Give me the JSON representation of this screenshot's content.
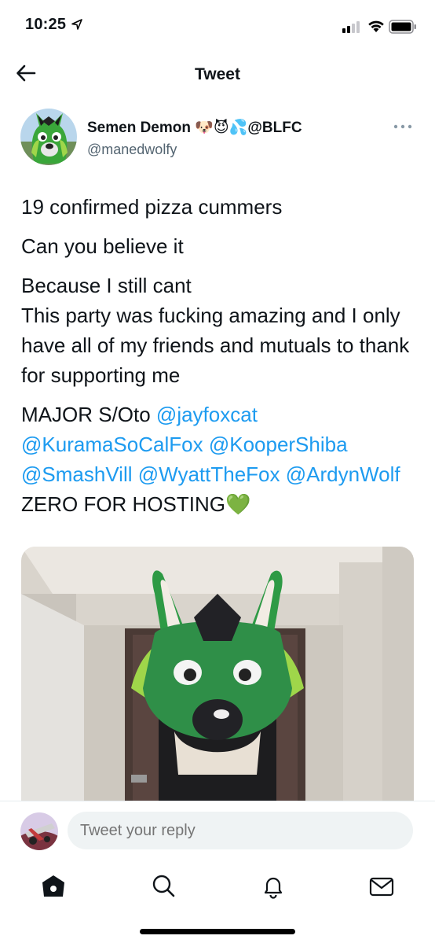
{
  "status": {
    "time": "10:25"
  },
  "nav": {
    "title": "Tweet"
  },
  "author": {
    "display_name": "Semen Demon 🐶😈💦@BLFC",
    "handle": "@manedwolfy"
  },
  "tweet": {
    "line1": "19 confirmed pizza cummers",
    "line2": "Can you believe it",
    "line3a": "Because I still cant",
    "line3b": "This party was fucking amazing and I only have all of my friends and mutuals to thank for supporting me",
    "line4_prefix": "MAJOR S/Oto ",
    "mentions": [
      "@jayfoxcat",
      "@KuramaSoCalFox",
      "@KooperShiba",
      "@SmashVill",
      "@WyattTheFox",
      "@ArdynWolf"
    ],
    "line4_suffix": " ZERO FOR HOSTING💚"
  },
  "reply": {
    "placeholder": "Tweet your reply"
  },
  "tabs": [
    "home-icon",
    "search-icon",
    "notifications-icon",
    "messages-icon"
  ]
}
